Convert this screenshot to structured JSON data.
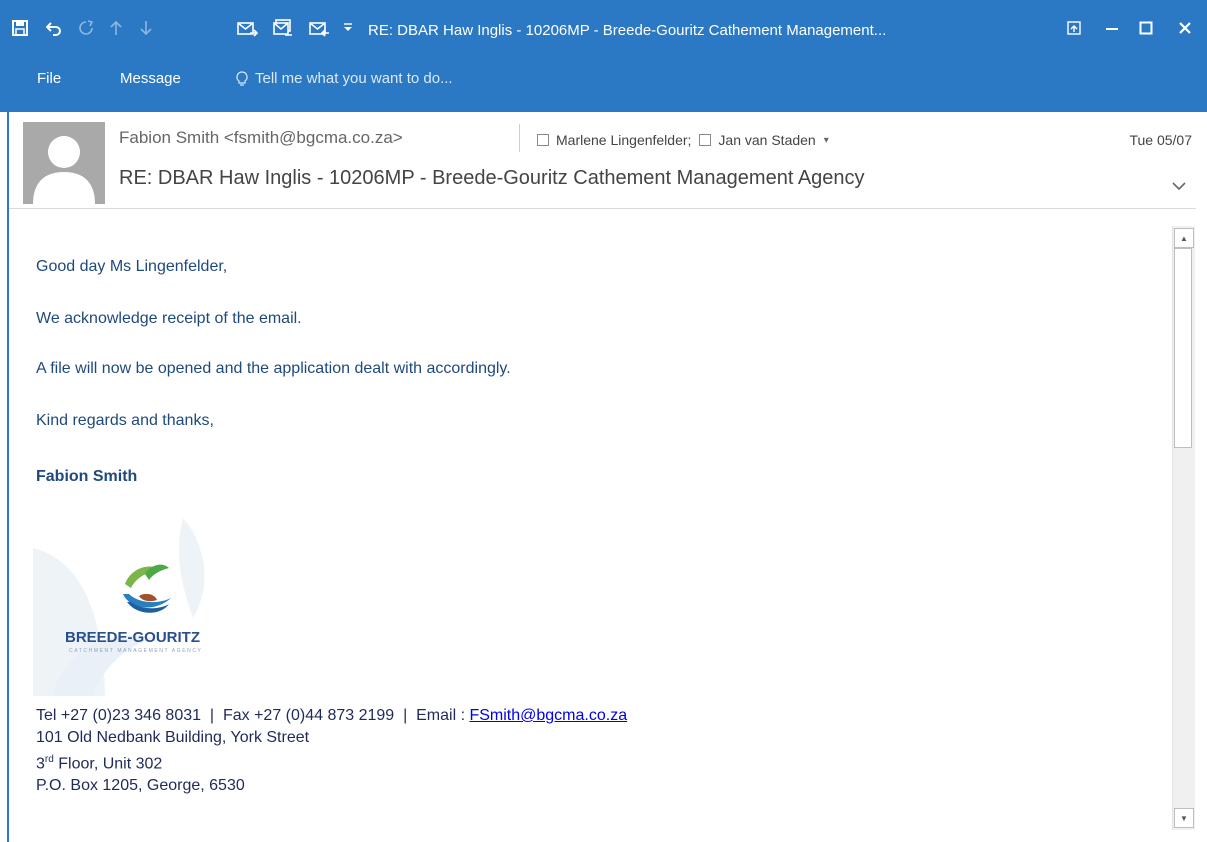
{
  "window": {
    "title": "RE: DBAR Haw Inglis - 10206MP - Breede-Gouritz Cathement Management...",
    "accent_color": "#2b79c4"
  },
  "quick_access": {
    "icons": [
      "save-icon",
      "undo-icon",
      "redo-icon",
      "previous-item-icon",
      "next-item-icon",
      "reply-icon",
      "reply-all-icon",
      "forward-icon",
      "customize-dropdown-icon"
    ]
  },
  "window_controls": {
    "icons": [
      "ribbon-display-options-icon",
      "minimize-icon",
      "maximize-icon",
      "close-icon"
    ]
  },
  "menu": {
    "file_label": "File",
    "message_label": "Message",
    "tell_me_placeholder": "Tell me what you want to do..."
  },
  "header": {
    "sender": "Fabion Smith <fsmith@bgcma.co.za>",
    "recipients": [
      "Marlene Lingenfelder;",
      "Jan van Staden"
    ],
    "date": "Tue 05/07",
    "subject": "RE: DBAR Haw Inglis - 10206MP - Breede-Gouritz Cathement Management Agency"
  },
  "body": {
    "greeting": "Good day Ms Lingenfelder,",
    "p1": "We acknowledge receipt of the email.",
    "p2": "A file will now be opened and the application dealt with accordingly.",
    "closing": "Kind regards and thanks,",
    "signer": "Fabion Smith"
  },
  "logo": {
    "name": "BREEDE-GOURITZ",
    "tagline": "CATCHMENT MANAGEMENT AGENCY"
  },
  "signature": {
    "tel": "Tel +27 (0)23 346 8031",
    "sep": "|",
    "fax": "Fax +27 (0)44 873 2199",
    "email_label": "Email : ",
    "email": "FSmith@bgcma.co.za",
    "address1": "101 Old Nedbank Building, York Street",
    "floor_num": "3",
    "floor_sup": "rd",
    "floor_rest": " Floor, Unit 302",
    "po_box": "P.O. Box 1205, George, 6530"
  }
}
